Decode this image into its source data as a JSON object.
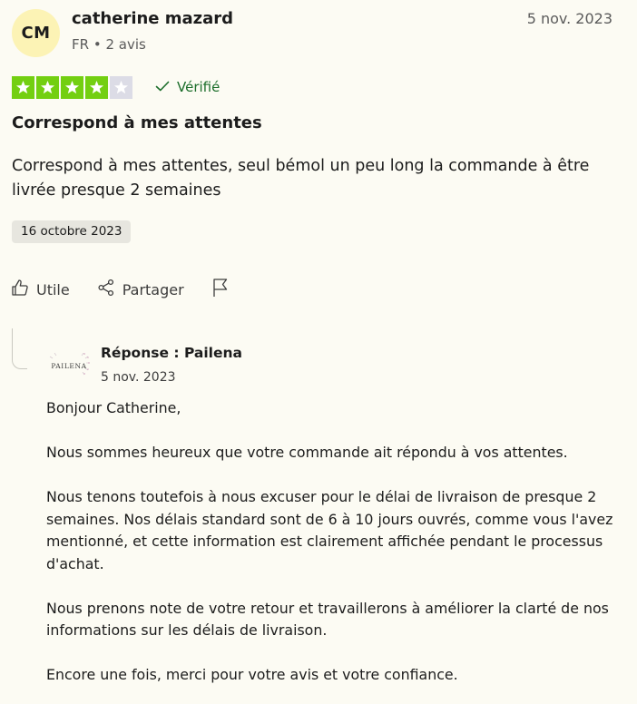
{
  "author": {
    "initials": "CM",
    "name": "catherine mazard",
    "country": "FR",
    "separator": "•",
    "reviews_count": "2 avis"
  },
  "review": {
    "date": "5 nov. 2023",
    "rating": 4,
    "max_rating": 5,
    "verified_label": "Vérifié",
    "title": "Correspond à mes attentes",
    "body": "Correspond à mes attentes, seul bémol un peu long la commande à être livrée presque 2 semaines",
    "experience_date": "16 octobre 2023"
  },
  "actions": {
    "useful_label": "Utile",
    "share_label": "Partager"
  },
  "reply": {
    "title": "Réponse : Pailena",
    "date": "5 nov. 2023",
    "logo_text": "PAILENA",
    "paragraphs": [
      "Bonjour Catherine,",
      "Nous sommes heureux que votre commande ait répondu à vos attentes.",
      "Nous tenons toutefois à nous excuser pour le délai de livraison de presque 2 semaines. Nos délais standard sont de 6 à 10 jours ouvrés, comme vous l'avez mentionné, et cette information est clairement affichée pendant le processus d'achat.",
      "Nous prenons note de votre retour et travaillerons à améliorer la clarté de nos informations sur les délais de livraison.",
      "Encore une fois, merci pour votre avis et votre confiance."
    ]
  },
  "colors": {
    "star_on": "#73cf11",
    "star_off": "#dcdce6",
    "verified": "#1b6d2a",
    "avatar_bg": "#fcf3b5",
    "background": "#fcfbf3"
  },
  "icons": {
    "star": "star-icon",
    "check": "check-icon",
    "thumbs_up": "thumbs-up-icon",
    "share": "share-icon",
    "flag": "flag-icon"
  }
}
